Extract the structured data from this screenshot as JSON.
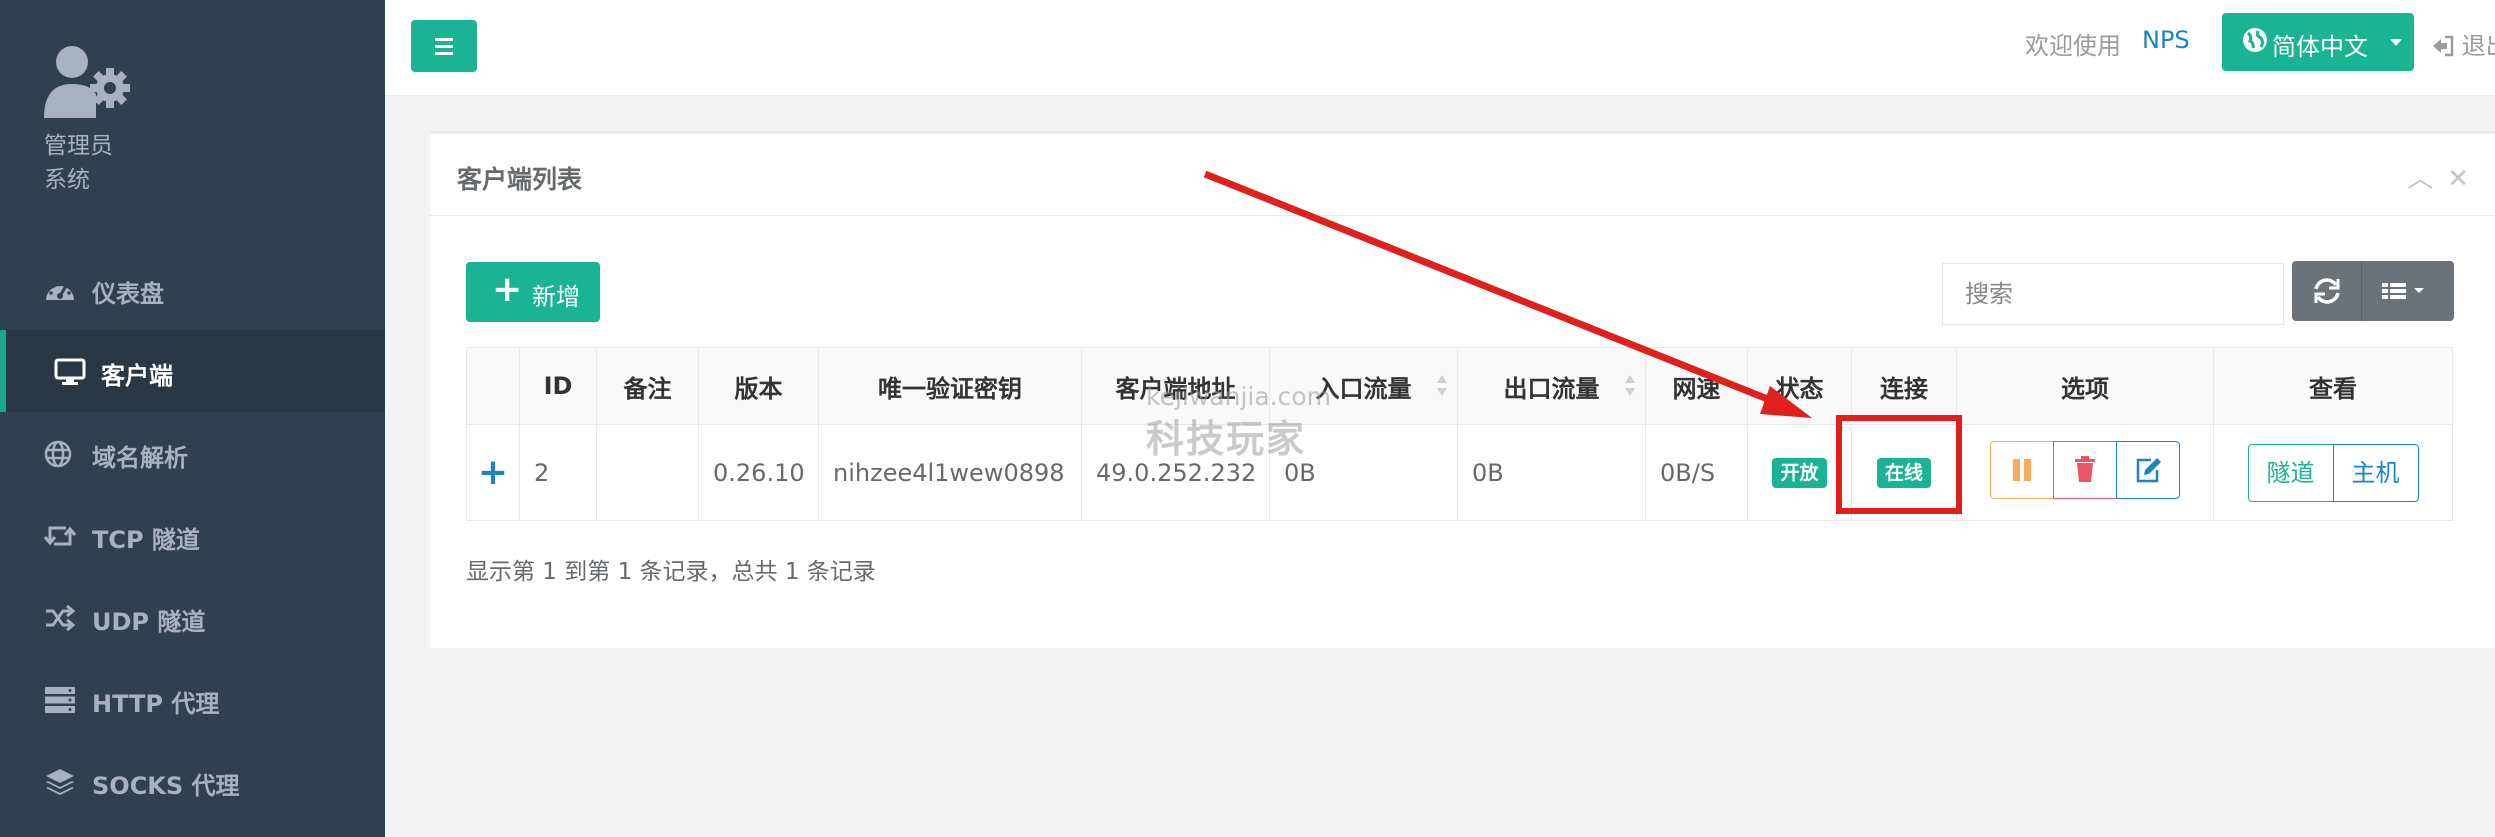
{
  "sidebar": {
    "profile": {
      "name": "管理员",
      "role": "系统"
    },
    "items": [
      {
        "label": "仪表盘",
        "icon": "dashboard-icon"
      },
      {
        "label": "客户端",
        "icon": "desktop-icon",
        "active": true
      },
      {
        "label": "域名解析",
        "icon": "globe-icon"
      },
      {
        "label": "TCP 隧道",
        "icon": "retweet-icon"
      },
      {
        "label": "UDP 隧道",
        "icon": "random-icon"
      },
      {
        "label": "HTTP 代理",
        "icon": "server-icon"
      },
      {
        "label": "SOCKS 代理",
        "icon": "layers-icon"
      }
    ]
  },
  "topbar": {
    "welcome": "欢迎使用",
    "brand": "NPS",
    "language": "简体中文",
    "logout": "退出"
  },
  "panel": {
    "title": "客户端列表",
    "add_label": "新增",
    "search_placeholder": "搜索",
    "columns": [
      "ID",
      "备注",
      "版本",
      "唯一验证密钥",
      "客户端地址",
      "入口流量",
      "出口流量",
      "网速",
      "状态",
      "连接",
      "选项",
      "查看"
    ],
    "rows": [
      {
        "id": "2",
        "remark": "",
        "version": "0.26.10",
        "vkey": "nihzee4l1wew0898",
        "address": "49.0.252.232",
        "inlet_flow": "0B",
        "export_flow": "0B",
        "speed": "0B/S",
        "status": "开放",
        "connection": "在线",
        "view_tunnel": "隧道",
        "view_host": "主机"
      }
    ],
    "footer": "显示第 1 到第 1 条记录，总共 1 条记录"
  },
  "overlay": {
    "watermark_line1": "kejiwanjia.com",
    "watermark_line2": "科技玩家",
    "arrow_color": "#e0201c"
  },
  "colors": {
    "sidebar_bg": "#2f4050",
    "primary": "#1ab394",
    "link": "#1c84c6",
    "warning": "#f8ac59",
    "danger": "#ed5565"
  }
}
